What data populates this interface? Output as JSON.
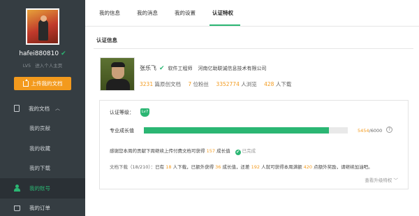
{
  "sidebar": {
    "username": "hafei880810",
    "level": "LV5",
    "homepage_link": "进入个人主页",
    "upload_button": "上传我的文档",
    "menu": {
      "my_docs": "我的文档",
      "contribution": "我的贡献",
      "favorites": "我的收藏",
      "downloads": "我的下载",
      "account": "我的账号",
      "orders": "我的订单"
    }
  },
  "tabs": [
    "我的信息",
    "我的消息",
    "我的设置",
    "认证特权"
  ],
  "active_tab": "认证特权",
  "section_title": "认证信息",
  "profile": {
    "name": "张乐飞",
    "title": "软件工程师",
    "company": "河南亿助联诚信息技术有限公司",
    "stats": {
      "docs_num": "3231",
      "docs_label": "篇原创文档",
      "fans_num": "7",
      "fans_label": "位粉丝",
      "views_num": "3352774",
      "views_label": "人浏览",
      "downloads_num": "428",
      "downloads_label": "人下载"
    }
  },
  "certification": {
    "level_label": "认证等级：",
    "level_badge": "Lv7",
    "growth_label": "专业成长值",
    "growth_current": "5454",
    "growth_total": "/6000",
    "growth_fraction": 0.909,
    "help": "?",
    "task_text": "感谢您本周的贡献下周继续上传付费文档可获得",
    "task_points": "157",
    "task_unit": "成长值",
    "task_done": "已完成",
    "dl_label": "文档下载（18/210）：",
    "dl_p1": "已有",
    "dl_n1": "18",
    "dl_p2": "人下载，已额外获得",
    "dl_n2": "36",
    "dl_p3": "成长值，还差",
    "dl_n3": "192",
    "dl_p4": "人就可获得本周满额",
    "dl_n4": "420",
    "dl_p5": "点额外奖励，请继续加油吧。",
    "view_more": "查看升级特权"
  }
}
